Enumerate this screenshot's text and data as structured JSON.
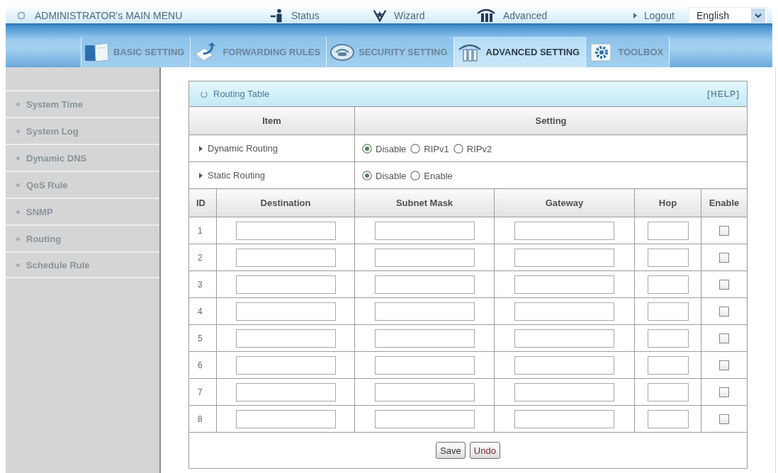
{
  "top_bar": {
    "title": "ADMINISTRATOR's MAIN MENU",
    "links": [
      {
        "kind": "status",
        "label": "Status"
      },
      {
        "kind": "wizard",
        "label": "Wizard"
      },
      {
        "kind": "advanced",
        "label": "Advanced"
      },
      {
        "kind": "logout",
        "label": "Logout"
      }
    ],
    "language": "English"
  },
  "nav_tabs": [
    {
      "kind": "basic",
      "label": "BASIC SETTING",
      "selected": false
    },
    {
      "kind": "forwarding",
      "label": "FORWARDING RULES",
      "selected": false
    },
    {
      "kind": "security",
      "label": "SECURITY SETTING",
      "selected": false
    },
    {
      "kind": "advanced",
      "label": "ADVANCED SETTING",
      "selected": true
    },
    {
      "kind": "toolbox",
      "label": "TOOLBOX",
      "selected": false
    }
  ],
  "sidebar": {
    "items": [
      "System Time",
      "System Log",
      "Dynamic DNS",
      "QoS Rule",
      "SNMP",
      "Routing",
      "Schedule Rule"
    ]
  },
  "routing_table": {
    "title": "Routing Table",
    "help": "[HELP]",
    "header": {
      "item": "Item",
      "setting": "Setting"
    },
    "settings": [
      {
        "label": "Dynamic Routing",
        "options": [
          {
            "label": "Disable",
            "selected": true
          },
          {
            "label": "RIPv1",
            "selected": false
          },
          {
            "label": "RIPv2",
            "selected": false
          }
        ]
      },
      {
        "label": "Static Routing",
        "options": [
          {
            "label": "Disable",
            "selected": true
          },
          {
            "label": "Enable",
            "selected": false
          }
        ]
      }
    ],
    "columns": [
      "ID",
      "Destination",
      "Subnet Mask",
      "Gateway",
      "Hop",
      "Enable"
    ],
    "rows": [
      {
        "id": "1",
        "checked": false
      },
      {
        "id": "2",
        "checked": false
      },
      {
        "id": "3",
        "checked": false
      },
      {
        "id": "4",
        "checked": false
      },
      {
        "id": "5",
        "checked": false
      },
      {
        "id": "6",
        "checked": false
      },
      {
        "id": "7",
        "checked": false
      },
      {
        "id": "8",
        "checked": false
      }
    ],
    "buttons": [
      {
        "kind": "save",
        "label": "Save"
      },
      {
        "kind": "undo",
        "label": "Undo"
      }
    ]
  }
}
